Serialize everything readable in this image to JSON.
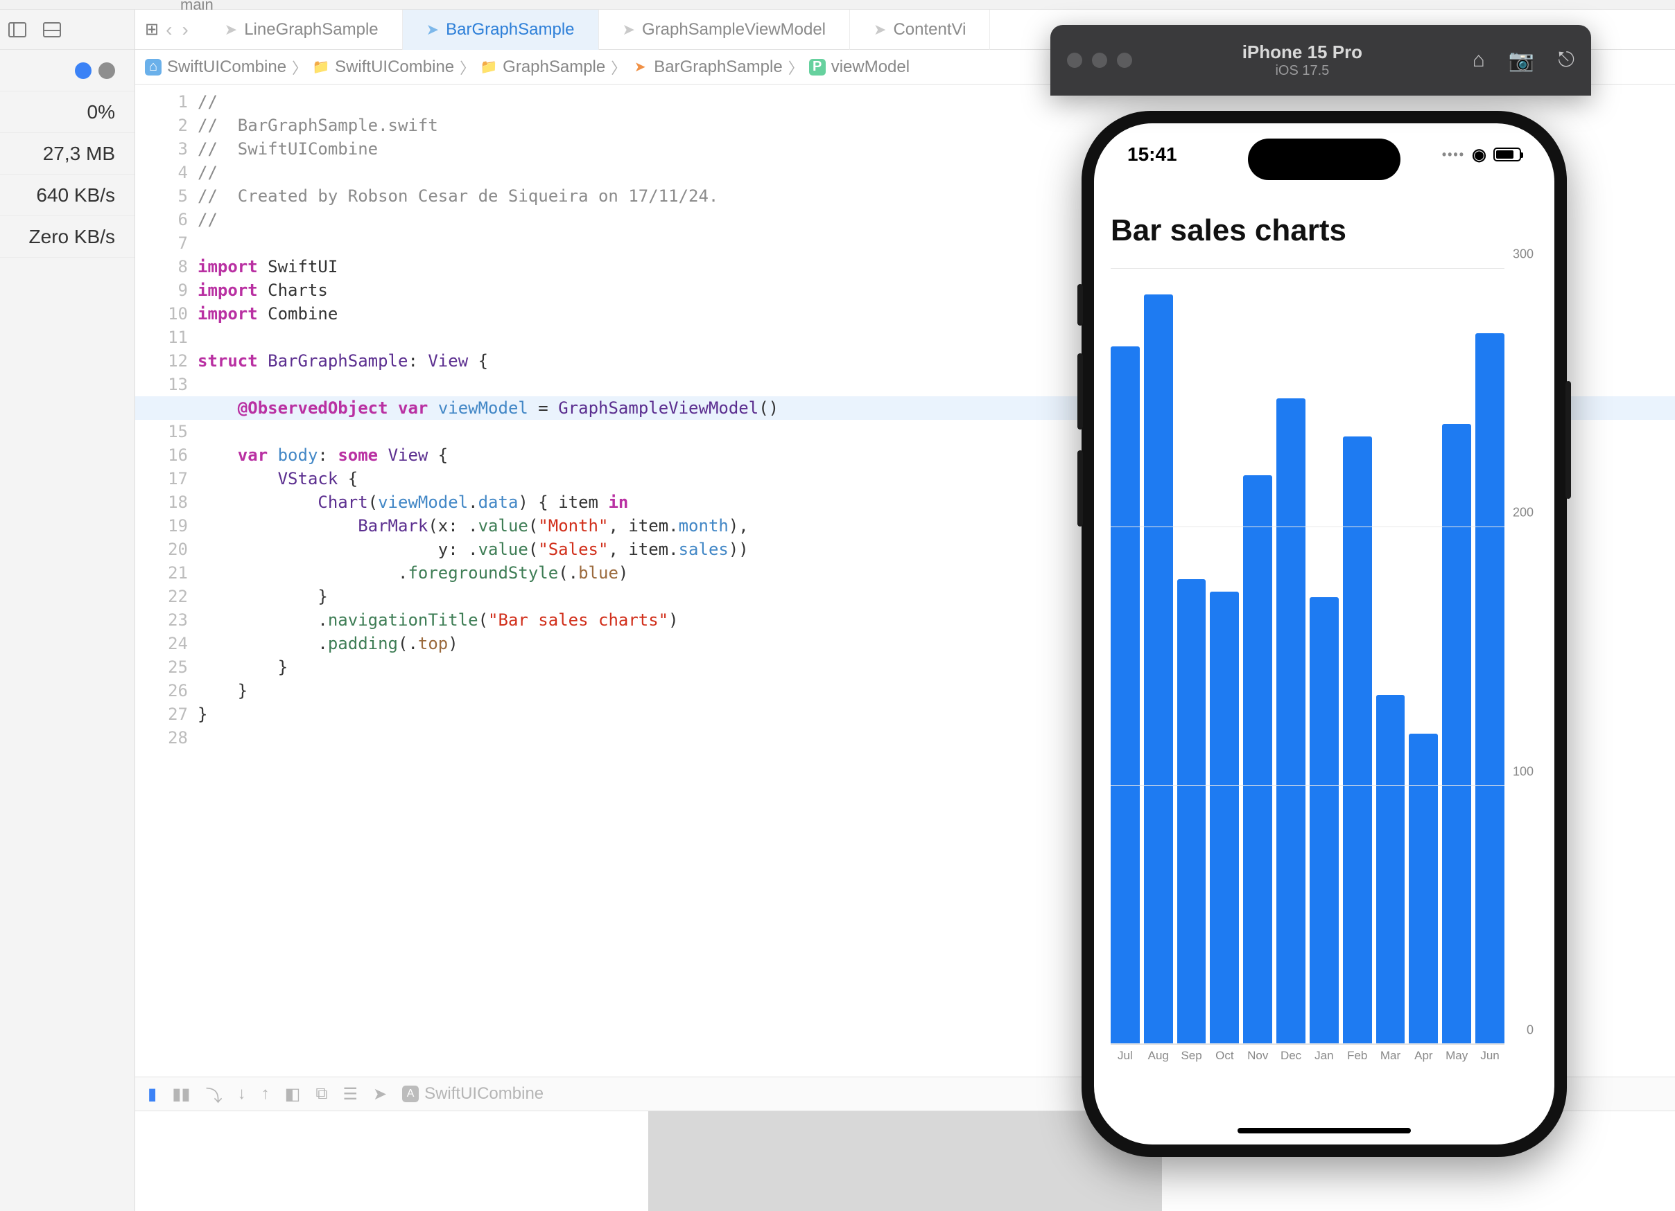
{
  "top_branch": "main",
  "sidebar": {
    "stats": [
      "0%",
      "27,3 MB",
      "640 KB/s",
      "Zero KB/s"
    ]
  },
  "tabs": [
    {
      "label": "LineGraphSample",
      "active": false
    },
    {
      "label": "BarGraphSample",
      "active": true
    },
    {
      "label": "GraphSampleViewModel",
      "active": false
    },
    {
      "label": "ContentVi",
      "active": false
    }
  ],
  "breadcrumb": [
    "SwiftUICombine",
    "SwiftUICombine",
    "GraphSample",
    "BarGraphSample",
    "viewModel"
  ],
  "debug": {
    "app": "SwiftUICombine"
  },
  "code_lines": 28,
  "highlighted_line": 14,
  "simulator": {
    "device": "iPhone 15 Pro",
    "os": "iOS 17.5",
    "time": "15:41"
  },
  "chart_data": {
    "type": "bar",
    "title": "Bar sales charts",
    "categories": [
      "Jul",
      "Aug",
      "Sep",
      "Oct",
      "Nov",
      "Dec",
      "Jan",
      "Feb",
      "Mar",
      "Apr",
      "May",
      "Jun"
    ],
    "values": [
      270,
      290,
      180,
      175,
      220,
      250,
      173,
      235,
      135,
      120,
      240,
      275
    ],
    "ylim": [
      0,
      300
    ],
    "yticks": [
      0,
      100,
      200,
      300
    ],
    "xlabel": "",
    "ylabel": ""
  }
}
